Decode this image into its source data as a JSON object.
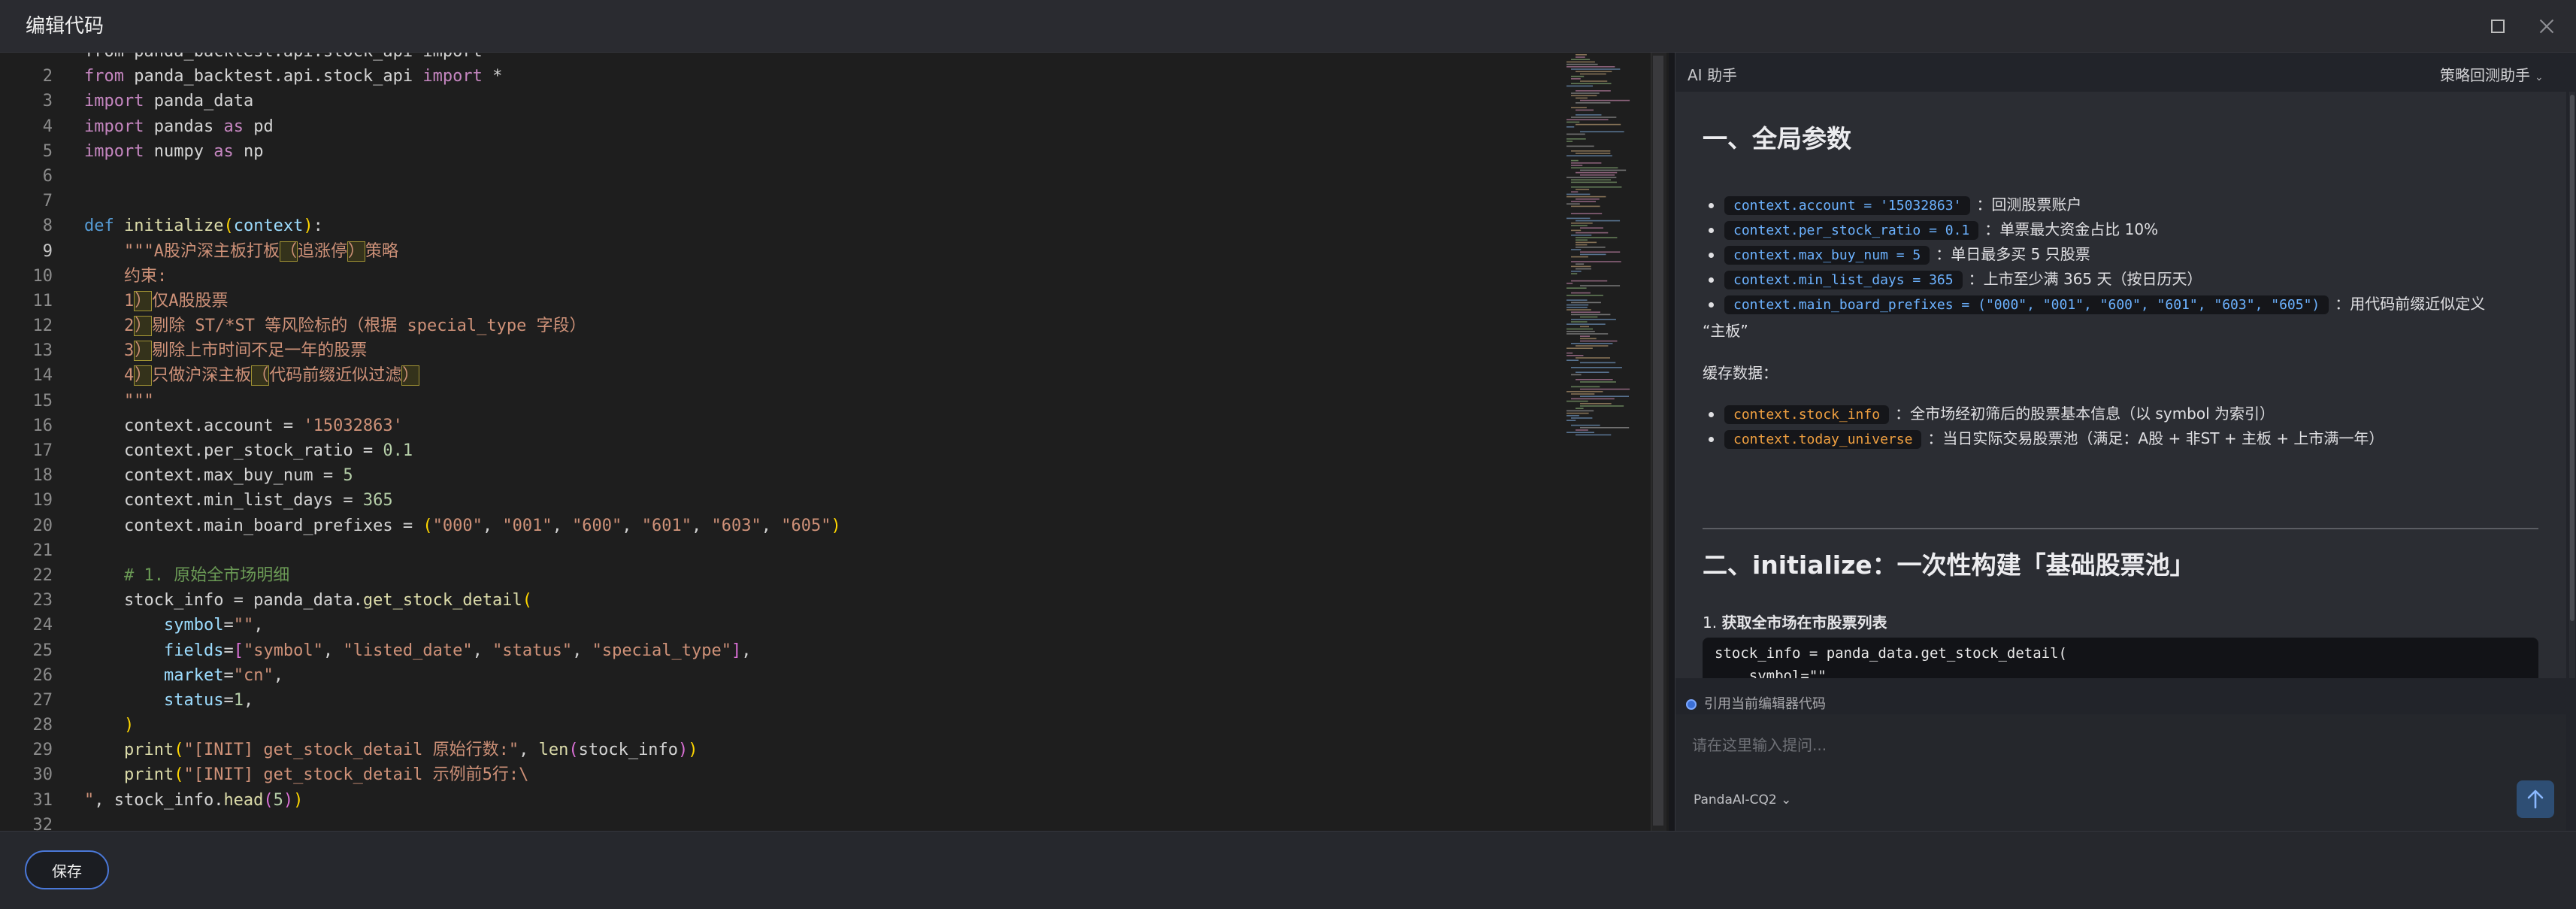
{
  "window": {
    "title": "编辑代码",
    "maximize_icon": "maximize-icon",
    "close_icon": "close-icon"
  },
  "editor": {
    "lines": [
      {
        "n": "",
        "html": "<span class='tok-id'>from panda_backtest.api.stock_api import *</span>"
      },
      {
        "n": "2",
        "html": "<span class='tok-kw2'>from</span> <span class='tok-id'>panda_backtest.api.stock_api</span> <span class='tok-kw2'>import</span> <span class='tok-id'>*</span>"
      },
      {
        "n": "3",
        "html": "<span class='tok-kw2'>import</span> <span class='tok-id'>panda_data</span>"
      },
      {
        "n": "4",
        "html": "<span class='tok-kw2'>import</span> <span class='tok-id'>pandas</span> <span class='tok-kw2'>as</span> <span class='tok-id'>pd</span>"
      },
      {
        "n": "5",
        "html": "<span class='tok-kw2'>import</span> <span class='tok-id'>numpy</span> <span class='tok-kw2'>as</span> <span class='tok-id'>np</span>"
      },
      {
        "n": "6",
        "html": ""
      },
      {
        "n": "7",
        "html": ""
      },
      {
        "n": "8",
        "html": "<span class='tok-kw'>def</span> <span class='tok-fn'>initialize</span><span class='tok-p1'>(</span><span class='tok-var'>context</span><span class='tok-p1'>)</span><span class='tok-id'>:</span>"
      },
      {
        "n": "9",
        "html": "    <span class='tok-str'>\"\"\"A股沪深主板打板<span class='box'>（</span>追涨停<span class='box'>）</span>策略</span>"
      },
      {
        "n": "10",
        "html": "    <span class='tok-str'>约束:</span>"
      },
      {
        "n": "11",
        "html": "    <span class='tok-str'>1<span class='box'>）</span>仅A股股票</span>"
      },
      {
        "n": "12",
        "html": "    <span class='tok-str'>2<span class='box'>）</span>剔除 ST/*ST 等风险标的（根据 special_type 字段）</span>"
      },
      {
        "n": "13",
        "html": "    <span class='tok-str'>3<span class='box'>）</span>剔除上市时间不足一年的股票</span>"
      },
      {
        "n": "14",
        "html": "    <span class='tok-str'>4<span class='box'>）</span>只做沪深主板<span class='box'>（</span>代码前缀近似过滤<span class='box'>）</span></span>"
      },
      {
        "n": "15",
        "html": "    <span class='tok-str'>\"\"\"</span>"
      },
      {
        "n": "16",
        "html": "    <span class='tok-id'>context.account = </span><span class='tok-str'>'15032863'</span>"
      },
      {
        "n": "17",
        "html": "    <span class='tok-id'>context.per_stock_ratio = </span><span class='tok-num'>0.1</span>"
      },
      {
        "n": "18",
        "html": "    <span class='tok-id'>context.max_buy_num = </span><span class='tok-num'>5</span>"
      },
      {
        "n": "19",
        "html": "    <span class='tok-id'>context.min_list_days = </span><span class='tok-num'>365</span>"
      },
      {
        "n": "20",
        "html": "    <span class='tok-id'>context.main_board_prefixes = </span><span class='tok-p1'>(</span><span class='tok-str'>\"000\"</span><span class='tok-id'>, </span><span class='tok-str'>\"001\"</span><span class='tok-id'>, </span><span class='tok-str'>\"600\"</span><span class='tok-id'>, </span><span class='tok-str'>\"601\"</span><span class='tok-id'>, </span><span class='tok-str'>\"603\"</span><span class='tok-id'>, </span><span class='tok-str'>\"605\"</span><span class='tok-p1'>)</span>"
      },
      {
        "n": "21",
        "html": ""
      },
      {
        "n": "22",
        "html": "    <span class='tok-cm'># 1. 原始全市场明细</span>"
      },
      {
        "n": "23",
        "html": "    <span class='tok-id'>stock_info = panda_data.</span><span class='tok-fn'>get_stock_detail</span><span class='tok-p1'>(</span>"
      },
      {
        "n": "24",
        "html": "        <span class='tok-var'>symbol</span><span class='tok-id'>=</span><span class='tok-str'>\"\"</span><span class='tok-id'>,</span>"
      },
      {
        "n": "25",
        "html": "        <span class='tok-var'>fields</span><span class='tok-id'>=</span><span class='tok-p2'>[</span><span class='tok-str'>\"symbol\"</span><span class='tok-id'>, </span><span class='tok-str'>\"listed_date\"</span><span class='tok-id'>, </span><span class='tok-str'>\"status\"</span><span class='tok-id'>, </span><span class='tok-str'>\"special_type\"</span><span class='tok-p2'>]</span><span class='tok-id'>,</span>"
      },
      {
        "n": "26",
        "html": "        <span class='tok-var'>market</span><span class='tok-id'>=</span><span class='tok-str'>\"cn\"</span><span class='tok-id'>,</span>"
      },
      {
        "n": "27",
        "html": "        <span class='tok-var'>status</span><span class='tok-id'>=</span><span class='tok-num'>1</span><span class='tok-id'>,</span>"
      },
      {
        "n": "28",
        "html": "    <span class='tok-p1'>)</span>"
      },
      {
        "n": "29",
        "html": "    <span class='tok-fn'>print</span><span class='tok-p1'>(</span><span class='tok-str'>\"[INIT] get_stock_detail 原始行数:\"</span><span class='tok-id'>, </span><span class='tok-fn'>len</span><span class='tok-p2'>(</span><span class='tok-id'>stock_info</span><span class='tok-p2'>)</span><span class='tok-p1'>)</span>"
      },
      {
        "n": "30",
        "html": "    <span class='tok-fn'>print</span><span class='tok-p1'>(</span><span class='tok-str'>\"[INIT] get_stock_detail 示例前5行:\\</span>"
      },
      {
        "n": "31",
        "html": "<span class='tok-str'>\"</span><span class='tok-id'>, stock_info.</span><span class='tok-fn'>head</span><span class='tok-p2'>(</span><span class='tok-num'>5</span><span class='tok-p2'>)</span><span class='tok-p1'>)</span>"
      },
      {
        "n": "32",
        "html": ""
      }
    ]
  },
  "ai": {
    "title": "AI 助手",
    "mode": "策略回测助手",
    "section1_title": "一、全局参数",
    "params": [
      {
        "code": "context.account = '15032863'",
        "desc": "：回测股票账户"
      },
      {
        "code": "context.per_stock_ratio = 0.1",
        "desc": "：单票最大资金占比 10%"
      },
      {
        "code": "context.max_buy_num = 5",
        "desc": "：单日最多买 5 只股票"
      },
      {
        "code": "context.min_list_days = 365",
        "desc": "：上市至少满 365 天（按日历天）"
      },
      {
        "code": "context.main_board_prefixes = (\"000\", \"001\", \"600\", \"601\", \"603\", \"605\")",
        "desc": "：用代码前缀近似定义"
      }
    ],
    "param_wrap": "“主板”",
    "cache_label": "缓存数据：",
    "cache": [
      {
        "code": "context.stock_info",
        "desc": "：全市场经初筛后的股票基本信息（以 symbol 为索引）"
      },
      {
        "code": "context.today_universe",
        "desc": "：当日实际交易股票池（满足：A股 + 非ST + 主板 + 上市满一年）"
      }
    ],
    "section2_title": "二、initialize：一次性构建「基础股票池」",
    "step1": "获取全市场在市股票列表",
    "step1_num": "1.",
    "code_block": "stock_info = panda_data.get_stock_detail(\n    symbol=\"\",",
    "ref_label": "引用当前编辑器代码",
    "prompt_placeholder": "请在这里输入提问...",
    "model": "PandaAI-CQ2"
  },
  "footer": {
    "save_label": "保存"
  }
}
